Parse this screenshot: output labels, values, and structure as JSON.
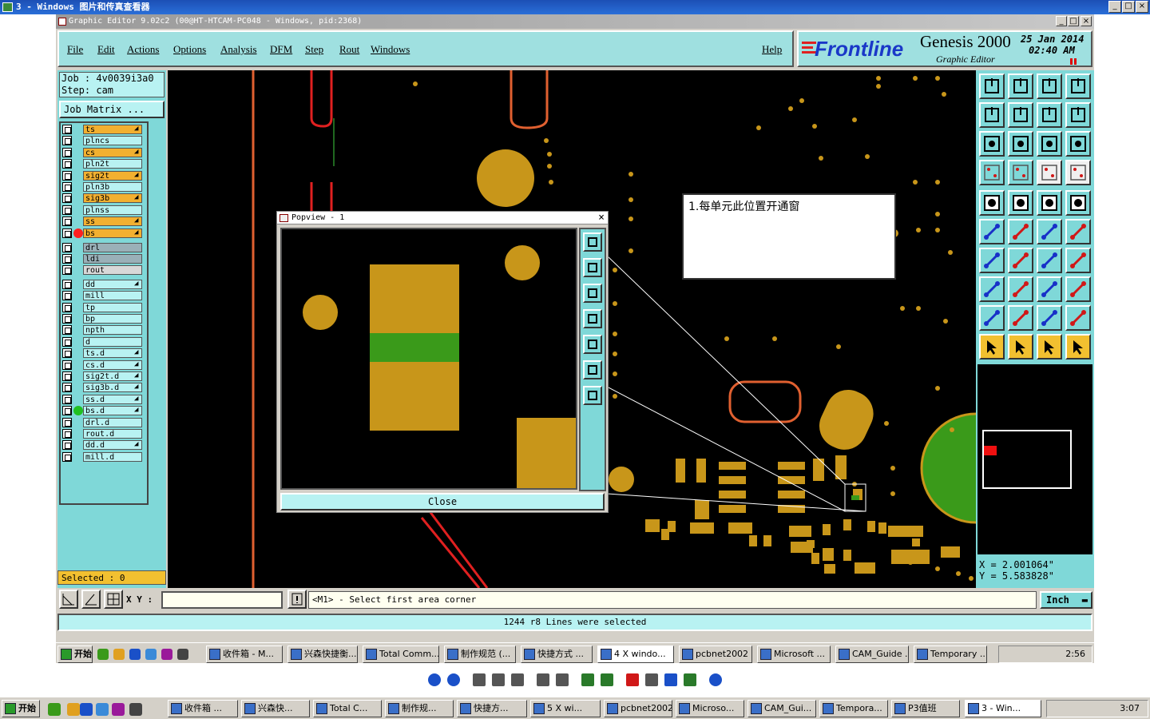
{
  "outer_window": {
    "title": "3 - Windows 图片和传真查看器",
    "btn_min": "_",
    "btn_max": "□",
    "btn_close": "×"
  },
  "app": {
    "title": "Graphic Editor 9.02c2 (00@HT-HTCAM-PC048 - Windows, pid:2368)",
    "menu": [
      "File",
      "Edit",
      "Actions",
      "Options",
      "Analysis",
      "DFM",
      "Step",
      "Rout",
      "Windows"
    ],
    "help": "Help",
    "brand_logo": "Frontline",
    "brand_product": "Genesis 2000",
    "brand_sub": "Graphic Editor",
    "date": "25 Jan 2014",
    "time": "02:40  AM"
  },
  "left": {
    "job": "Job : 4v0039i3a0",
    "step": "Step: cam",
    "job_matrix": "Job Matrix ...",
    "selected": "Selected : 0",
    "layers": [
      {
        "name": "ts",
        "color": "#f2b030",
        "arrow": true
      },
      {
        "name": "plncs",
        "color": "#b8f2f2",
        "arrow": false
      },
      {
        "name": "cs",
        "color": "#f2b030",
        "arrow": true
      },
      {
        "name": "pln2t",
        "color": "#b8f2f2",
        "arrow": false
      },
      {
        "name": "sig2t",
        "color": "#f2b030",
        "arrow": true
      },
      {
        "name": "pln3b",
        "color": "#b8f2f2",
        "arrow": false
      },
      {
        "name": "sig3b",
        "color": "#f2b030",
        "arrow": true
      },
      {
        "name": "plnss",
        "color": "#b8f2f2",
        "arrow": false
      },
      {
        "name": "ss",
        "color": "#f2b030",
        "arrow": true
      },
      {
        "name": "bs",
        "color": "#f2b030",
        "arrow": true,
        "mark": "#ff2020"
      },
      {
        "name": "drl",
        "color": "#9ab0b8",
        "arrow": false
      },
      {
        "name": "ldi",
        "color": "#9ab0b8",
        "arrow": false
      },
      {
        "name": "rout",
        "color": "#d8d8d8",
        "arrow": false
      },
      {
        "name": "dd",
        "color": "#b8f2f2",
        "arrow": true
      },
      {
        "name": "mill",
        "color": "#b8f2f2",
        "arrow": false
      },
      {
        "name": "tp",
        "color": "#b8f2f2",
        "arrow": false
      },
      {
        "name": "bp",
        "color": "#b8f2f2",
        "arrow": false
      },
      {
        "name": "npth",
        "color": "#b8f2f2",
        "arrow": false
      },
      {
        "name": "d",
        "color": "#b8f2f2",
        "arrow": false
      },
      {
        "name": "ts.d",
        "color": "#b8f2f2",
        "arrow": true
      },
      {
        "name": "cs.d",
        "color": "#b8f2f2",
        "arrow": true
      },
      {
        "name": "sig2t.d",
        "color": "#b8f2f2",
        "arrow": true
      },
      {
        "name": "sig3b.d",
        "color": "#b8f2f2",
        "arrow": true
      },
      {
        "name": "ss.d",
        "color": "#b8f2f2",
        "arrow": true
      },
      {
        "name": "bs.d",
        "color": "#b8f2f2",
        "arrow": true,
        "mark": "#20c020"
      },
      {
        "name": "drl.d",
        "color": "#b8f2f2",
        "arrow": false
      },
      {
        "name": "rout.d",
        "color": "#b8f2f2",
        "arrow": false
      },
      {
        "name": "dd.d",
        "color": "#b8f2f2",
        "arrow": true
      },
      {
        "name": "mill.d",
        "color": "#b8f2f2",
        "arrow": false
      }
    ]
  },
  "popview": {
    "title": "Popview - 1",
    "close_label": "Close",
    "close_x": "×"
  },
  "note": "1.每单元此位置开通窗",
  "coords": {
    "x": "X  =  2.001064\"",
    "y": "Y  =  5.583828\""
  },
  "status": {
    "xy_label": "X Y :",
    "xy_value": "",
    "hint": "<M1> - Select first area corner",
    "unit": "Inch"
  },
  "message": "1244 r8 Lines were selected",
  "inner_taskbar": {
    "start": "开始",
    "items": [
      "收件箱 - M...",
      "兴森快捷衡...",
      "Total Comm...",
      "制作规范 (...",
      "快捷方式 ...",
      "4 X windo...",
      "pcbnet2002",
      "Microsoft ...",
      "CAM_Guide ...",
      "Temporary ..."
    ],
    "time": "2:56"
  },
  "outer_taskbar": {
    "start": "开始",
    "items": [
      "收件箱 ...",
      "兴森快...",
      "Total C...",
      "制作规...",
      "快捷方...",
      "5 X wi...",
      "pcbnet2002",
      "Microso...",
      "CAM_Gui...",
      "Tempora...",
      "P3值班",
      "3 - Win..."
    ],
    "time": "3:07"
  },
  "colors": {
    "copper": "#c8961a",
    "green": "#3a9a1a",
    "cyan_panel": "#7fd8d8",
    "pad_dark": "#b58a18"
  }
}
